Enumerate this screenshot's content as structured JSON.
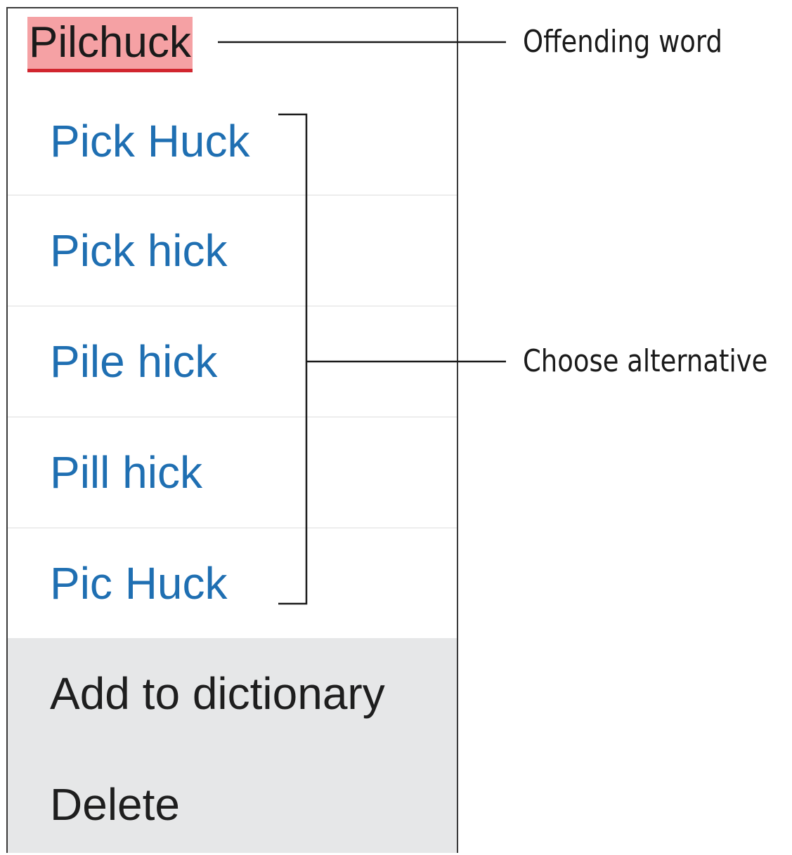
{
  "menu": {
    "offending_word": "Pilchuck",
    "suggestions": [
      {
        "label": "Pick Huck"
      },
      {
        "label": "Pick hick"
      },
      {
        "label": "Pile hick"
      },
      {
        "label": "Pill hick"
      },
      {
        "label": "Pic Huck"
      }
    ],
    "actions": {
      "add_to_dictionary": "Add to dictionary",
      "delete": "Delete"
    }
  },
  "callouts": {
    "offending_word": "Offending word",
    "choose_alternative": "Choose alternative"
  },
  "colors": {
    "suggestion_text": "#1f6fb2",
    "highlight": "#f5a1a4",
    "underline": "#d1262f",
    "actions_background": "#e6e7e8"
  }
}
